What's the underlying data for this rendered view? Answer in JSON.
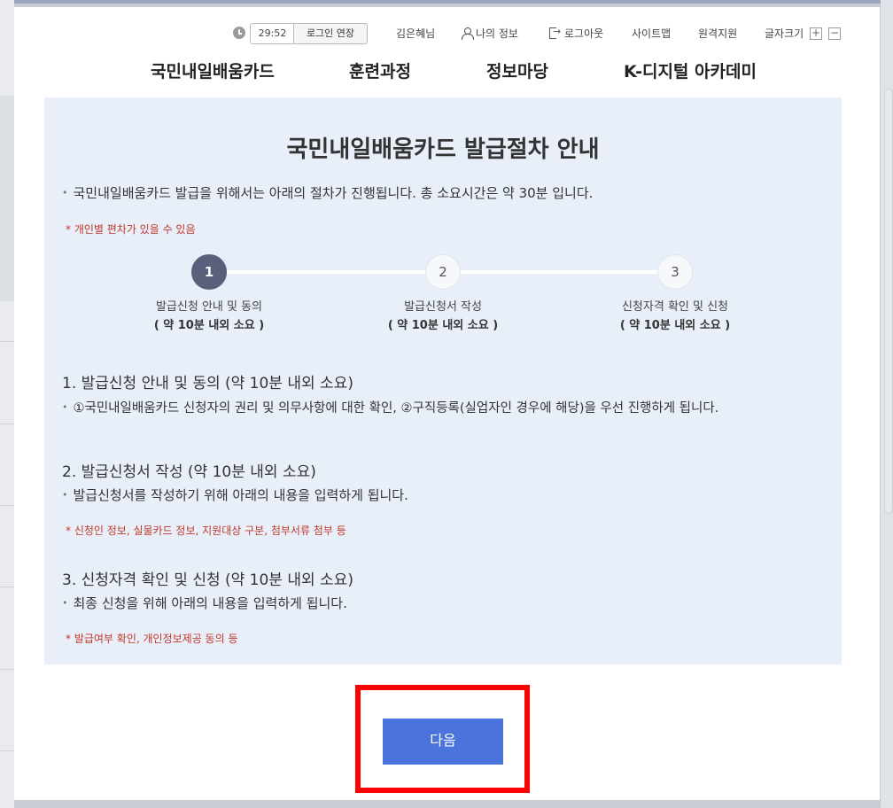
{
  "utility": {
    "timer": "29:52",
    "extend_login": "로그인 연장",
    "user_name": "김은혜님",
    "my_info": "나의 정보",
    "logout": "로그아웃",
    "sitemap": "사이트맵",
    "remote_support": "원격지원",
    "font_size": "글자크기",
    "font_plus": "+",
    "font_minus": "−"
  },
  "nav": {
    "items": [
      "국민내일배움카드",
      "훈련과정",
      "정보마당",
      "K-디지털 아카데미"
    ]
  },
  "panel": {
    "title": "국민내일배움카드 발급절차 안내",
    "intro": "국민내일배움카드 발급을 위해서는 아래의 절차가 진행됩니다. 총 소요시간은 약 30분 입니다.",
    "intro_note": "* 개인별 편차가 있을 수 있음",
    "steps": [
      {
        "num": "1",
        "label": "발급신청 안내 및 동의",
        "duration": "( 약 10분 내외 소요 )"
      },
      {
        "num": "2",
        "label": "발급신청서 작성",
        "duration": "( 약 10분 내외 소요 )"
      },
      {
        "num": "3",
        "label": "신청자격 확인 및 신청",
        "duration": "( 약 10분 내외 소요 )"
      }
    ],
    "sections": [
      {
        "title": "1. 발급신청 안내 및 동의 (약 10분 내외 소요)",
        "desc": "①국민내일배움카드 신청자의 권리 및 의무사항에 대한 확인, ②구직등록(실업자인 경우에 해당)을 우선 진행하게 됩니다.",
        "note": ""
      },
      {
        "title": "2. 발급신청서 작성 (약 10분 내외 소요)",
        "desc": "발급신청서를 작성하기 위해 아래의 내용을 입력하게 됩니다.",
        "note": "* 신청인 정보, 실물카드 정보, 지원대상 구분, 첨부서류 첨부 등"
      },
      {
        "title": "3. 신청자격 확인 및 신청 (약 10분 내외 소요)",
        "desc": "최종 신청을 위해 아래의 내용을 입력하게 됩니다.",
        "note": "* 발급여부 확인, 개인정보제공 동의 등"
      }
    ]
  },
  "actions": {
    "next": "다음"
  },
  "colors": {
    "panel_bg": "#e8eff9",
    "active_step": "#5a5f7c",
    "next_button": "#4a73dc",
    "note_text": "#c0392b",
    "highlight_border": "#ff0000"
  }
}
